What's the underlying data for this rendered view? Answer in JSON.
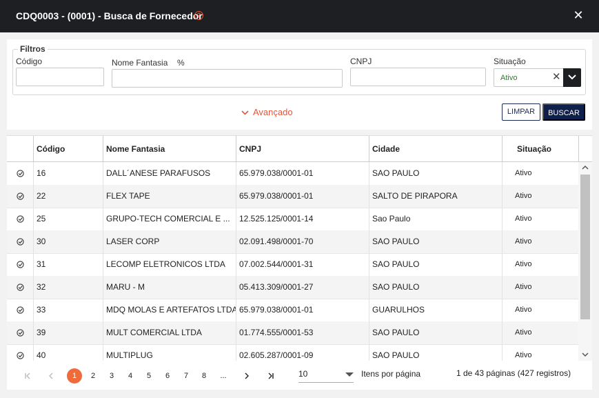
{
  "window": {
    "title": "CDQ0003 - (0001) - Busca de Fornecedor",
    "help_glyph": "?",
    "close_glyph": "✕"
  },
  "filters": {
    "legend": "Filtros",
    "codigo_label": "Código",
    "nome_label": "Nome Fantasia",
    "nome_hint": "%",
    "cnpj_label": "CNPJ",
    "situacao_label": "Situação",
    "situacao_value": "Ativo",
    "advanced_label": "Avançado",
    "limpar_label": "LIMPAR",
    "buscar_label": "BUSCAR"
  },
  "table": {
    "headers": [
      "Código",
      "Nome Fantasia",
      "CNPJ",
      "Cidade",
      "Situação"
    ],
    "rows": [
      {
        "codigo": "16",
        "nome": "DALL´ANESE PARAFUSOS",
        "cnpj": "65.979.038/0001-01",
        "cidade": "SAO PAULO",
        "situacao": "Ativo"
      },
      {
        "codigo": "22",
        "nome": "FLEX TAPE",
        "cnpj": "65.979.038/0001-01",
        "cidade": "SALTO DE PIRAPORA",
        "situacao": "Ativo"
      },
      {
        "codigo": "25",
        "nome": "GRUPO-TECH COMERCIAL E ...",
        "cnpj": "12.525.125/0001-14",
        "cidade": "Sao Paulo",
        "situacao": "Ativo"
      },
      {
        "codigo": "30",
        "nome": "LASER CORP",
        "cnpj": "02.091.498/0001-70",
        "cidade": "SAO PAULO",
        "situacao": "Ativo"
      },
      {
        "codigo": "31",
        "nome": "LECOMP ELETRONICOS LTDA",
        "cnpj": "07.002.544/0001-31",
        "cidade": "SAO PAULO",
        "situacao": "Ativo"
      },
      {
        "codigo": "32",
        "nome": "MARU - M",
        "cnpj": "05.413.309/0001-27",
        "cidade": "SAO PAULO",
        "situacao": "Ativo"
      },
      {
        "codigo": "33",
        "nome": "MDQ MOLAS E ARTEFATOS LTDA",
        "cnpj": "65.979.038/0001-01",
        "cidade": "GUARULHOS",
        "situacao": "Ativo"
      },
      {
        "codigo": "39",
        "nome": "MULT COMERCIAL LTDA",
        "cnpj": "01.774.555/0001-53",
        "cidade": "SAO PAULO",
        "situacao": "Ativo"
      },
      {
        "codigo": "40",
        "nome": "MULTIPLUG",
        "cnpj": "02.605.287/0001-09",
        "cidade": "SAO PAULO",
        "situacao": "Ativo"
      }
    ]
  },
  "pagination": {
    "pages": [
      "1",
      "2",
      "3",
      "4",
      "5",
      "6",
      "7",
      "8",
      "..."
    ],
    "current_page": "1",
    "per_page": "10",
    "per_page_label": "Itens por página",
    "info": "1 de 43 páginas (427 registros)"
  },
  "colors": {
    "accent": "#ef6c3a",
    "titlebar": "#1e1f22",
    "primary_button": "#0d1f4a",
    "status_active": "#2a7a2a"
  }
}
